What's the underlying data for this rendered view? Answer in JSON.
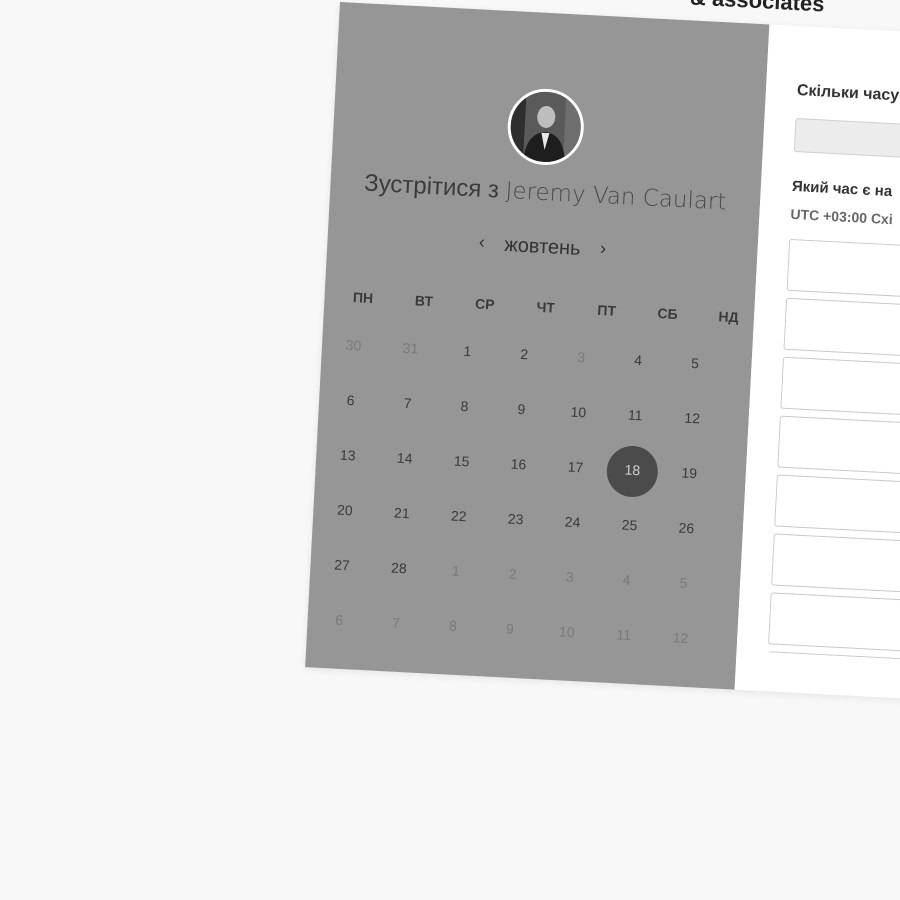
{
  "header": {
    "brand_partial": "& associates"
  },
  "calendar": {
    "meet_prefix": "Зустрітися з",
    "host_name": "Jeremy Van Caulart",
    "month": "жовтень",
    "prev_icon": "chevron-left-icon",
    "next_icon": "chevron-right-icon",
    "prev_label": "‹",
    "next_label": "›",
    "weekdays": [
      "ПН",
      "ВТ",
      "СР",
      "ЧТ",
      "ПТ",
      "СБ",
      "НД"
    ],
    "weeks": [
      [
        {
          "d": "30",
          "faded": true
        },
        {
          "d": "31",
          "faded": true
        },
        {
          "d": "1"
        },
        {
          "d": "2"
        },
        {
          "d": "3",
          "faded": true
        },
        {
          "d": "4"
        },
        {
          "d": "5"
        }
      ],
      [
        {
          "d": "6"
        },
        {
          "d": "7"
        },
        {
          "d": "8"
        },
        {
          "d": "9"
        },
        {
          "d": "10"
        },
        {
          "d": "11"
        },
        {
          "d": "12"
        }
      ],
      [
        {
          "d": "13"
        },
        {
          "d": "14"
        },
        {
          "d": "15"
        },
        {
          "d": "16"
        },
        {
          "d": "17"
        },
        {
          "d": "18",
          "selected": true
        },
        {
          "d": "19"
        }
      ],
      [
        {
          "d": "20"
        },
        {
          "d": "21"
        },
        {
          "d": "22"
        },
        {
          "d": "23"
        },
        {
          "d": "24"
        },
        {
          "d": "25"
        },
        {
          "d": "26"
        }
      ],
      [
        {
          "d": "27"
        },
        {
          "d": "28"
        },
        {
          "d": "1",
          "faded": true
        },
        {
          "d": "2",
          "faded": true
        },
        {
          "d": "3",
          "faded": true
        },
        {
          "d": "4",
          "faded": true
        },
        {
          "d": "5",
          "faded": true
        }
      ],
      [
        {
          "d": "6",
          "faded": true
        },
        {
          "d": "7",
          "faded": true
        },
        {
          "d": "8",
          "faded": true
        },
        {
          "d": "9",
          "faded": true
        },
        {
          "d": "10",
          "faded": true
        },
        {
          "d": "11",
          "faded": true
        },
        {
          "d": "12",
          "faded": true
        }
      ]
    ],
    "selected_day": "18"
  },
  "booking": {
    "duration_question": "Скільки часу",
    "duration_value": "",
    "time_question": "Який час є на",
    "timezone": "UTC +03:00 Схі",
    "slot_count_visible": 8
  },
  "colors": {
    "left_panel": "#969696",
    "selected_day": "#4b4b4b",
    "page_bg": "#f8f8f8"
  }
}
